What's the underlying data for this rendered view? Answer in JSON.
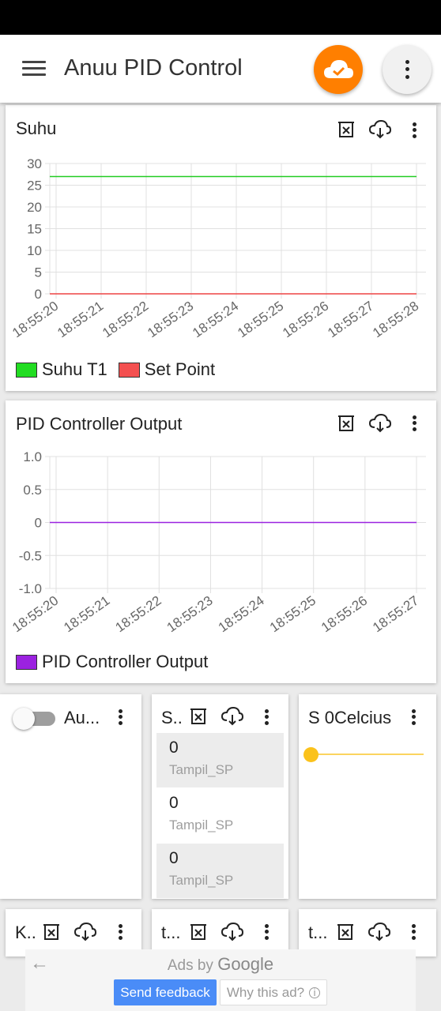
{
  "app": {
    "title": "Anuu PID Control"
  },
  "suhu": {
    "title": "Suhu",
    "chart_data": {
      "type": "line",
      "categories": [
        "18:55:20",
        "18:55:21",
        "18:55:22",
        "18:55:23",
        "18:55:24",
        "18:55:25",
        "18:55:26",
        "18:55:27",
        "18:55:28"
      ],
      "yticks": [
        "30",
        "25",
        "20",
        "15",
        "10",
        "5",
        "0"
      ],
      "ylim": [
        0,
        30
      ],
      "series": [
        {
          "name": "Suhu T1",
          "color": "#22cc22",
          "values": [
            27,
            27,
            27,
            27,
            27,
            27,
            27,
            27,
            27
          ]
        },
        {
          "name": "Set Point",
          "color": "#ee4444",
          "values": [
            0,
            0,
            0,
            0,
            0,
            0,
            0,
            0,
            0
          ]
        }
      ],
      "grid": true,
      "legend": "bottom-left"
    }
  },
  "pid": {
    "title": "PID Controller Output",
    "chart_data": {
      "type": "line",
      "categories": [
        "18:55:20",
        "18:55:21",
        "18:55:22",
        "18:55:23",
        "18:55:24",
        "18:55:25",
        "18:55:26",
        "18:55:27"
      ],
      "yticks": [
        "1.0",
        "0.5",
        "0",
        "-0.5",
        "-1.0"
      ],
      "ylim": [
        -1,
        1
      ],
      "series": [
        {
          "name": "PID Controller Output",
          "color": "#9b22e0",
          "values": [
            0,
            0,
            0,
            0,
            0,
            0,
            0,
            0
          ]
        }
      ],
      "grid": true,
      "legend": "bottom-left"
    }
  },
  "widgets": {
    "auto": {
      "label": "Au...",
      "toggle_on": false
    },
    "setpoint": {
      "title": "S..",
      "rows": [
        {
          "value": "0",
          "label": "Tampil_SP"
        },
        {
          "value": "0",
          "label": "Tampil_SP"
        },
        {
          "value": "0",
          "label": "Tampil_SP"
        }
      ]
    },
    "slider": {
      "label": "S 0Celcius",
      "level": 0,
      "color": "#fbc21b"
    },
    "bottom": [
      {
        "title": "K.."
      },
      {
        "title": "t..."
      },
      {
        "title": "t..."
      }
    ]
  },
  "ads": {
    "ads_by": "Ads by",
    "google": "Google",
    "send_feedback": "Send feedback",
    "why_ad": "Why this ad?"
  }
}
